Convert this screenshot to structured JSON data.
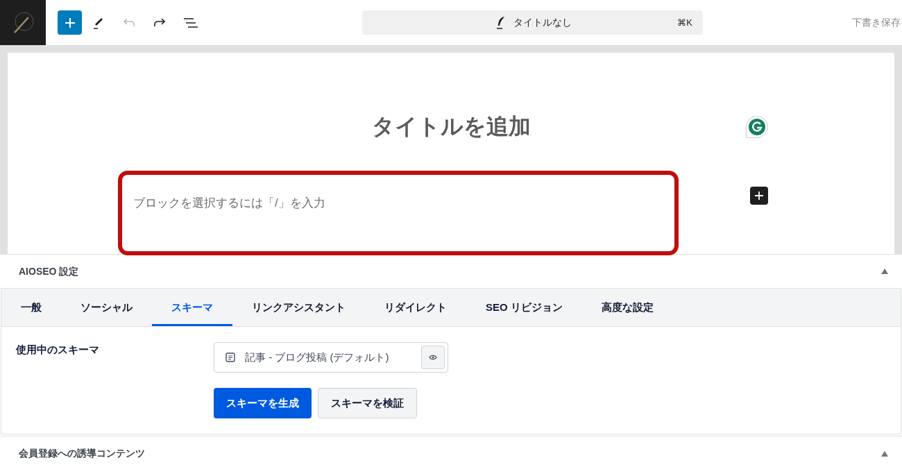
{
  "toolbar": {
    "document_title": "タイトルなし",
    "shortcut": "⌘K",
    "save_draft": "下書き保存",
    "undo_disabled": true
  },
  "editor": {
    "title_placeholder": "タイトルを追加",
    "block_placeholder": "ブロックを選択するには「/」を入力"
  },
  "aioseo": {
    "title": "AIOSEO 設定",
    "expanded": true,
    "tabs": [
      {
        "label": "一般",
        "selected": false
      },
      {
        "label": "ソーシャル",
        "selected": false
      },
      {
        "label": "スキーマ",
        "selected": true
      },
      {
        "label": "リンクアシスタント",
        "selected": false
      },
      {
        "label": "リダイレクト",
        "selected": false
      },
      {
        "label": "SEO リビジョン",
        "selected": false
      },
      {
        "label": "高度な設定",
        "selected": false
      }
    ],
    "schema_label": "使用中のスキーマ",
    "schema_item": "記事 - ブログ投稿 (デフォルト)",
    "buttons": [
      {
        "label": "スキーマを生成",
        "kind": "primary"
      },
      {
        "label": "スキーマを検証",
        "kind": "secondary"
      }
    ]
  },
  "second_panel": {
    "title": "会員登録への誘導コンテンツ",
    "expanded": true
  }
}
